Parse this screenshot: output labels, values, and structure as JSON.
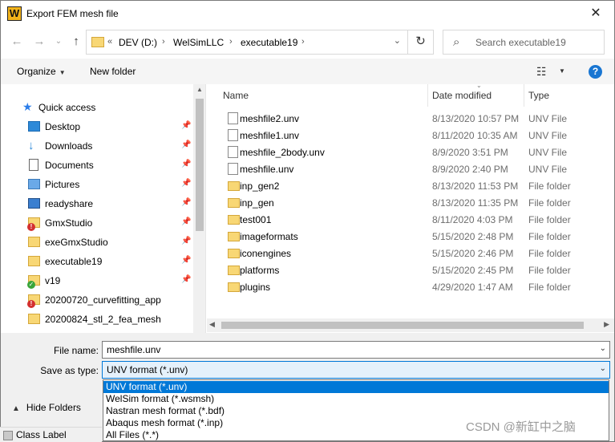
{
  "window": {
    "title": "Export FEM mesh file",
    "app_icon_letter": "W",
    "close_glyph": "✕"
  },
  "nav": {
    "address_prefix": "«",
    "breadcrumb": [
      "DEV (D:)",
      "WelSimLLC",
      "executable19"
    ],
    "search_placeholder": "Search executable19"
  },
  "toolbar": {
    "organize_label": "Organize",
    "new_folder_label": "New folder",
    "help_label": "?"
  },
  "sidebar": {
    "items": [
      {
        "label": "Quick access",
        "icon": "star-icon",
        "pinned": false
      },
      {
        "label": "Desktop",
        "icon": "desktop-icon",
        "pinned": true
      },
      {
        "label": "Downloads",
        "icon": "download-icon",
        "pinned": true
      },
      {
        "label": "Documents",
        "icon": "document-icon",
        "pinned": true
      },
      {
        "label": "Pictures",
        "icon": "pictures-icon",
        "pinned": true
      },
      {
        "label": "readyshare",
        "icon": "network-drive-icon",
        "pinned": true
      },
      {
        "label": "GmxStudio",
        "icon": "folder-error-icon",
        "pinned": true
      },
      {
        "label": "exeGmxStudio",
        "icon": "folder-icon",
        "pinned": true
      },
      {
        "label": "executable19",
        "icon": "folder-icon",
        "pinned": true
      },
      {
        "label": "v19",
        "icon": "folder-sync-icon",
        "pinned": true
      },
      {
        "label": "20200720_curvefitting_app",
        "icon": "folder-error-icon",
        "pinned": false
      },
      {
        "label": "20200824_stl_2_fea_mesh",
        "icon": "folder-icon",
        "pinned": false
      }
    ]
  },
  "file_list": {
    "columns": [
      "Name",
      "Date modified",
      "Type"
    ],
    "rows": [
      {
        "name": "meshfile2.unv",
        "date": "8/13/2020 10:57 PM",
        "type": "UNV File",
        "kind": "file"
      },
      {
        "name": "meshfile1.unv",
        "date": "8/11/2020 10:35 AM",
        "type": "UNV File",
        "kind": "file"
      },
      {
        "name": "meshfile_2body.unv",
        "date": "8/9/2020 3:51 PM",
        "type": "UNV File",
        "kind": "file"
      },
      {
        "name": "meshfile.unv",
        "date": "8/9/2020 2:40 PM",
        "type": "UNV File",
        "kind": "file"
      },
      {
        "name": "inp_gen2",
        "date": "8/13/2020 11:53 PM",
        "type": "File folder",
        "kind": "folder"
      },
      {
        "name": "inp_gen",
        "date": "8/13/2020 11:35 PM",
        "type": "File folder",
        "kind": "folder"
      },
      {
        "name": "test001",
        "date": "8/11/2020 4:03 PM",
        "type": "File folder",
        "kind": "folder"
      },
      {
        "name": "imageformats",
        "date": "5/15/2020 2:48 PM",
        "type": "File folder",
        "kind": "folder"
      },
      {
        "name": "iconengines",
        "date": "5/15/2020 2:46 PM",
        "type": "File folder",
        "kind": "folder"
      },
      {
        "name": "platforms",
        "date": "5/15/2020 2:45 PM",
        "type": "File folder",
        "kind": "folder"
      },
      {
        "name": "plugins",
        "date": "4/29/2020 1:47 AM",
        "type": "File folder",
        "kind": "folder"
      }
    ]
  },
  "form": {
    "file_name_label": "File name:",
    "file_name_value": "meshfile.unv",
    "save_type_label": "Save as type:",
    "save_type_value": "UNV format (*.unv)",
    "hide_folders_label": "Hide Folders"
  },
  "type_dropdown": {
    "options": [
      "UNV format (*.unv)",
      "WelSim format (*.wsmsh)",
      "Nastran mesh format (*.bdf)",
      "Abaqus mesh format (*.inp)",
      "All Files (*.*)"
    ],
    "selected_index": 0
  },
  "statusbar": {
    "label": "Class Label"
  },
  "watermark": "CSDN @新缸中之脑",
  "colors": {
    "accent": "#0078d7",
    "folder": "#f8d775",
    "help": "#1976d2"
  }
}
